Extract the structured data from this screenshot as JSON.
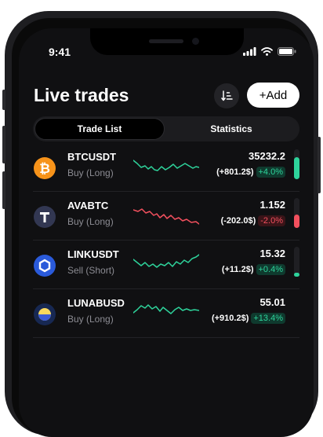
{
  "status_bar": {
    "time": "9:41"
  },
  "header": {
    "title": "Live trades",
    "add_label": "+Add"
  },
  "tabs": [
    {
      "label": "Trade List",
      "active": true
    },
    {
      "label": "Statistics",
      "active": false
    }
  ],
  "colors": {
    "up": "#2ed39b",
    "down": "#f2505e"
  },
  "trades": [
    {
      "pair": "BTCUSDT",
      "side": "Buy (Long)",
      "price": "35232.2",
      "pnl": "(+801.2$)",
      "change": "+4.0%",
      "direction": "up",
      "icon": "bitcoin-icon",
      "level": 0.75
    },
    {
      "pair": "AVABTC",
      "side": "Buy (Long)",
      "price": "1.152",
      "pnl": "(-202.0$)",
      "change": "-2.0%",
      "direction": "down",
      "icon": "ava-icon",
      "level": 0.45
    },
    {
      "pair": "LINKUSDT",
      "side": "Sell (Short)",
      "price": "15.32",
      "pnl": "(+11.2$)",
      "change": "+0.4%",
      "direction": "up",
      "icon": "chainlink-icon",
      "level": 0.12
    },
    {
      "pair": "LUNABUSD",
      "side": "Buy (Long)",
      "price": "55.01",
      "pnl": "(+910.2$)",
      "change": "+13.4%",
      "direction": "up",
      "icon": "luna-icon",
      "level": 0
    }
  ]
}
